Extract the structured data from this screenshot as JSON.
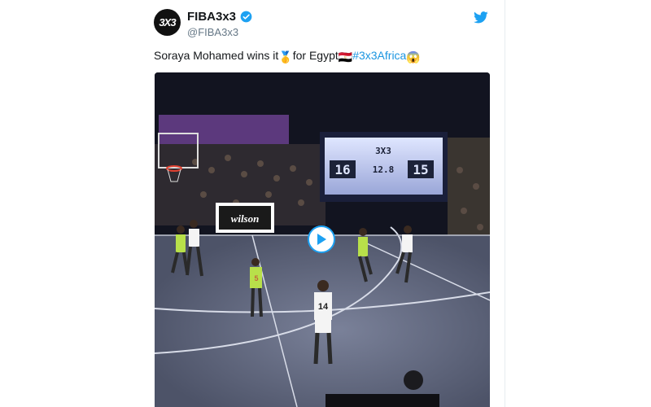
{
  "tweet": {
    "display_name": "FIBA3x3",
    "handle": "@FIBA3x3",
    "avatar_text": "3X3",
    "text_part1": "Soraya Mohamed wins it",
    "text_part2": "for Egypt",
    "hashtag": "#3x3Africa",
    "medal_emoji": "🥇",
    "flag_emoji": "🇪🇬",
    "shock_emoji": "😱"
  },
  "video": {
    "banner_text": "wilson",
    "scoreboard_home": "16",
    "scoreboard_away": "15",
    "scoreboard_clock": "12.8",
    "scoreboard_logo": "3X3",
    "jersey_number_near": "14",
    "jersey_number_green": "5"
  },
  "colors": {
    "accent": "#1da1f2",
    "text": "#14171a",
    "muted": "#657786",
    "hashtag": "#1b95e0",
    "court": "#5d6478"
  },
  "icons": {
    "verified": "verified-badge-icon",
    "bird": "twitter-bird-icon",
    "play": "play-icon"
  }
}
